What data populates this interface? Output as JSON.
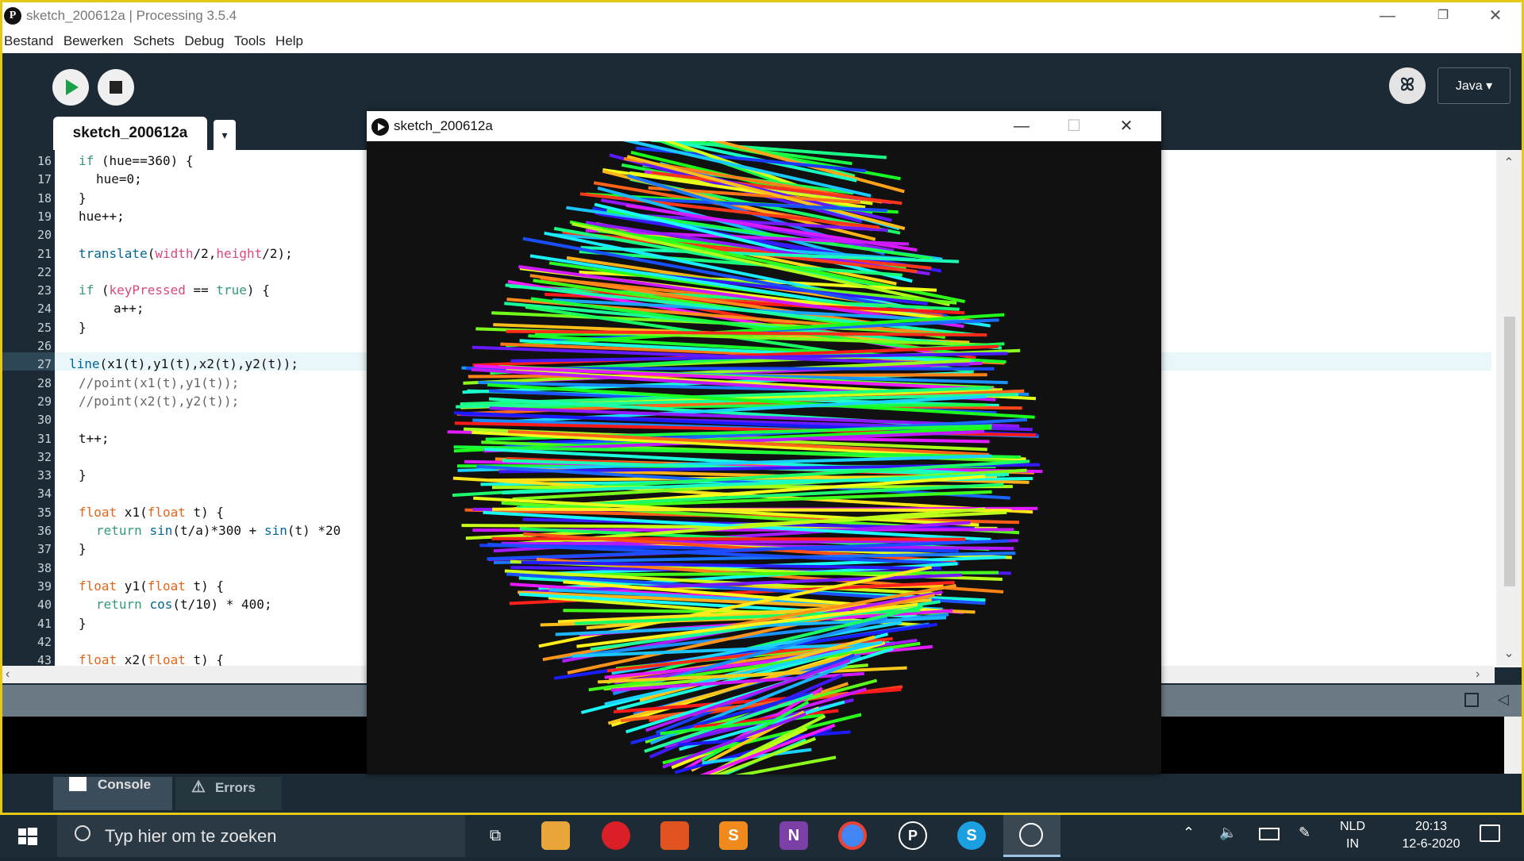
{
  "window": {
    "title": "sketch_200612a | Processing 3.5.4",
    "logo_glyph": "P"
  },
  "menu": [
    "Bestand",
    "Bewerken",
    "Schets",
    "Debug",
    "Tools",
    "Help"
  ],
  "toolbar": {
    "mode_label": "Java ▾",
    "debug_glyph": "ꕤ"
  },
  "tabs": {
    "active": "sketch_200612a",
    "menu_glyph": "▾"
  },
  "code_lines": [
    {
      "n": "16",
      "html": "if (hue==360) {",
      "indent": 0
    },
    {
      "n": "17",
      "html": "hue=0;",
      "indent": 1
    },
    {
      "n": "18",
      "html": "}",
      "indent": 0
    },
    {
      "n": "19",
      "html": "hue++;",
      "indent": 0
    },
    {
      "n": "20",
      "html": "",
      "indent": 0
    },
    {
      "n": "21",
      "html": "translate(width/2,height/2);",
      "indent": 0
    },
    {
      "n": "22",
      "html": "",
      "indent": 0
    },
    {
      "n": "23",
      "html": "if (keyPressed == true) {",
      "indent": 0
    },
    {
      "n": "24",
      "html": "a++;",
      "indent": 2
    },
    {
      "n": "25",
      "html": "}",
      "indent": 0
    },
    {
      "n": "26",
      "html": "",
      "indent": 0
    },
    {
      "n": "27",
      "html": "line(x1(t),y1(t),x2(t),y2(t));",
      "indent": -1
    },
    {
      "n": "28",
      "html": "//point(x1(t),y1(t));",
      "indent": 0
    },
    {
      "n": "29",
      "html": "//point(x2(t),y2(t));",
      "indent": 0
    },
    {
      "n": "30",
      "html": "",
      "indent": 0
    },
    {
      "n": "31",
      "html": "t++;",
      "indent": 0
    },
    {
      "n": "32",
      "html": "",
      "indent": 0
    },
    {
      "n": "33",
      "html": "}",
      "indent": 0
    },
    {
      "n": "34",
      "html": "",
      "indent": 0
    },
    {
      "n": "35",
      "html": "float x1(float t) {",
      "indent": 0
    },
    {
      "n": "36",
      "html": "return sin(t/a)*300 + sin(t) *20",
      "indent": 1
    },
    {
      "n": "37",
      "html": "}",
      "indent": 0
    },
    {
      "n": "38",
      "html": "",
      "indent": 0
    },
    {
      "n": "39",
      "html": "float y1(float t) {",
      "indent": 0
    },
    {
      "n": "40",
      "html": "return cos(t/10) * 400;",
      "indent": 1
    },
    {
      "n": "41",
      "html": "}",
      "indent": 0
    },
    {
      "n": "42",
      "html": "",
      "indent": 0
    },
    {
      "n": "43",
      "html": "float x2(float t) {",
      "indent": 0
    }
  ],
  "bottom_tabs": {
    "console": "Console",
    "errors": "Errors"
  },
  "sketch_window": {
    "title": "sketch_200612a"
  },
  "taskbar": {
    "search_placeholder": "Typ hier om te zoeken",
    "language": "NLD",
    "language_sub": "IN",
    "time": "20:13",
    "date": "12-6-2020"
  },
  "colors": {
    "accent_border": "#e6c817",
    "ide_dark": "#1b2a35",
    "run_green": "#1ba04a"
  }
}
